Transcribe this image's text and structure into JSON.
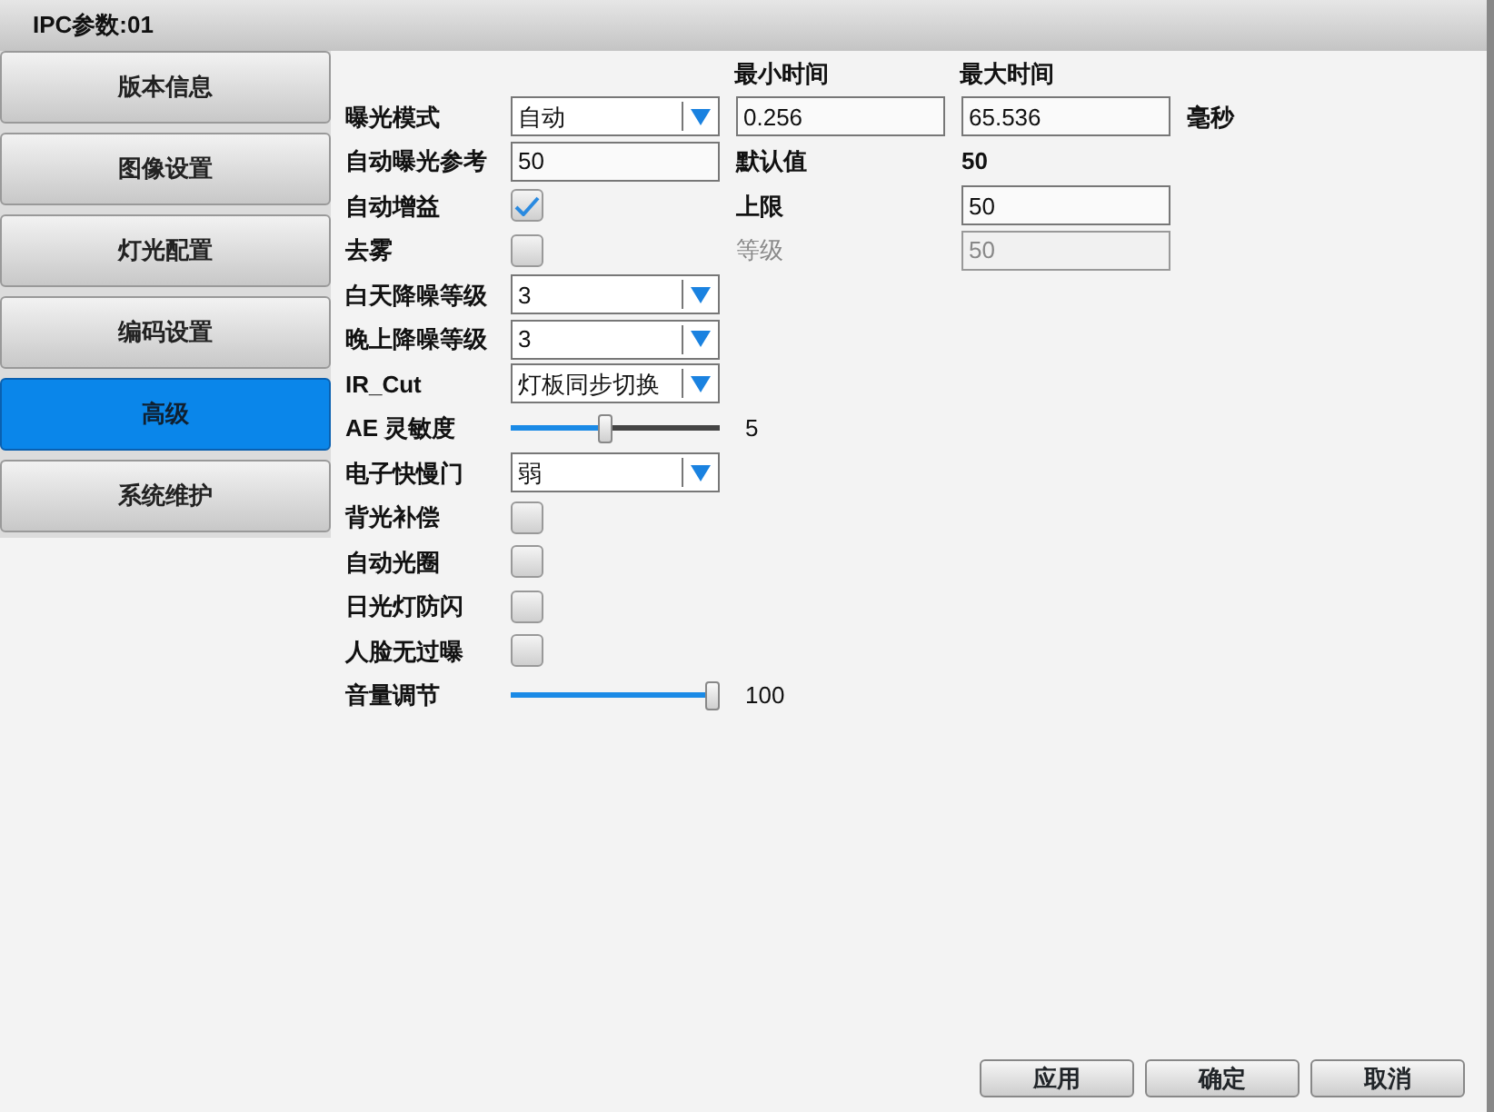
{
  "window": {
    "title": "IPC参数:01"
  },
  "sidebar": {
    "items": [
      {
        "label": "版本信息",
        "selected": false
      },
      {
        "label": "图像设置",
        "selected": false
      },
      {
        "label": "灯光配置",
        "selected": false
      },
      {
        "label": "编码设置",
        "selected": false
      },
      {
        "label": "高级",
        "selected": true
      },
      {
        "label": "系统维护",
        "selected": false
      }
    ]
  },
  "column_headings": [
    "最小时间",
    "最大时间"
  ],
  "rows": [
    {
      "label": "曝光模式",
      "control": {
        "kind": "select",
        "value": "自动"
      },
      "extras": [
        {
          "kind": "field",
          "text": "0.256",
          "disabled": false
        },
        {
          "kind": "field",
          "text": "65.536",
          "disabled": false
        },
        {
          "kind": "text",
          "text": "毫秒",
          "disabled": false
        }
      ]
    },
    {
      "label": "自动曝光参考",
      "control": {
        "kind": "field",
        "value": "50"
      },
      "extras": [
        {
          "kind": "text",
          "text": "默认值",
          "disabled": false
        },
        {
          "kind": "text",
          "text": "50",
          "disabled": false
        }
      ]
    },
    {
      "label": "自动增益",
      "control": {
        "kind": "checkbox",
        "checked": true
      },
      "extras": [
        {
          "kind": "text",
          "text": "上限",
          "disabled": false
        },
        {
          "kind": "field",
          "text": "50",
          "disabled": false
        }
      ]
    },
    {
      "label": "去雾",
      "control": {
        "kind": "checkbox",
        "checked": false
      },
      "extras": [
        {
          "kind": "text",
          "text": "等级",
          "disabled": true
        },
        {
          "kind": "field",
          "text": "50",
          "disabled": true
        }
      ]
    },
    {
      "label": "白天降噪等级",
      "control": {
        "kind": "select",
        "value": "3"
      }
    },
    {
      "label": "晚上降噪等级",
      "control": {
        "kind": "select",
        "value": "3"
      }
    },
    {
      "label": "IR_Cut",
      "control": {
        "kind": "select",
        "value": "灯板同步切换"
      }
    },
    {
      "label": "AE 灵敏度",
      "control": {
        "kind": "slider",
        "level": 0.45,
        "reading": "5"
      }
    },
    {
      "label": "电子快慢门",
      "control": {
        "kind": "select",
        "value": "弱"
      }
    },
    {
      "label": "背光补偿",
      "control": {
        "kind": "checkbox",
        "checked": false
      }
    },
    {
      "label": "自动光圈",
      "control": {
        "kind": "checkbox",
        "checked": false
      }
    },
    {
      "label": "日光灯防闪",
      "control": {
        "kind": "checkbox",
        "checked": false
      }
    },
    {
      "label": "人脸无过曝",
      "control": {
        "kind": "checkbox",
        "checked": false
      }
    },
    {
      "label": "音量调节",
      "control": {
        "kind": "slider",
        "level": 1.0,
        "reading": "100"
      }
    }
  ],
  "buttons": [
    "应用",
    "确定",
    "取消"
  ]
}
